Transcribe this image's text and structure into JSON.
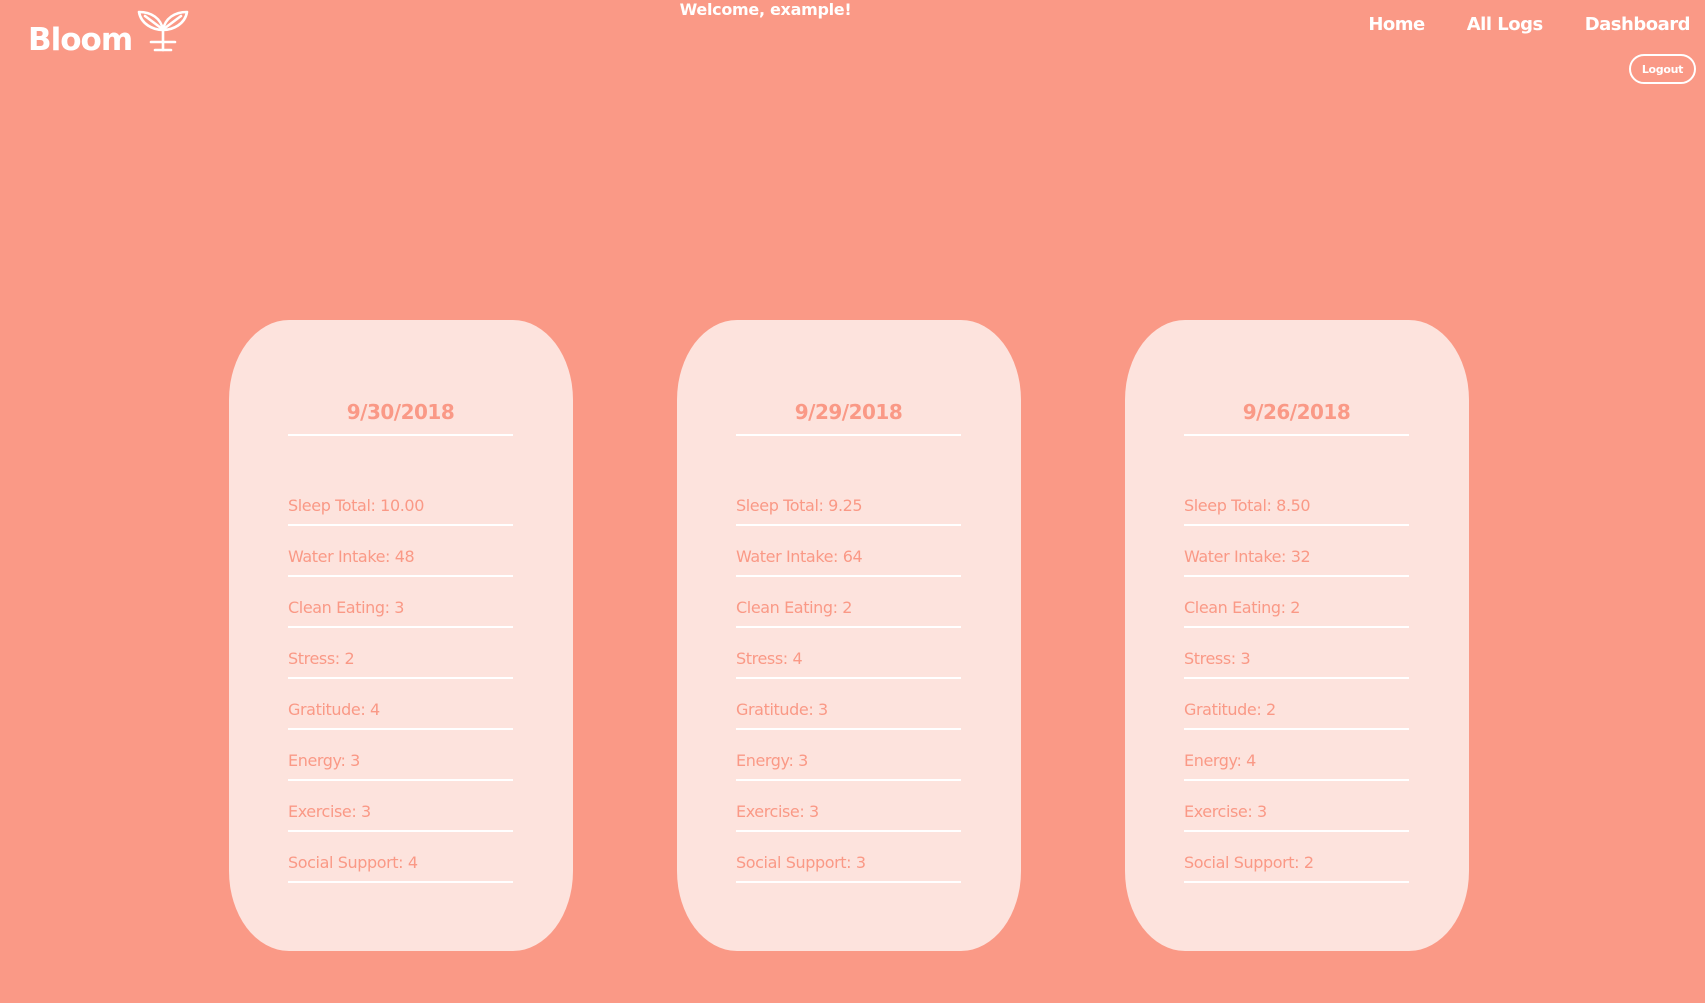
{
  "header": {
    "logo_text": "Bloom",
    "logo_icon": "sprout-icon",
    "welcome": "Welcome, example!",
    "nav": [
      {
        "label": "Home"
      },
      {
        "label": "All Logs"
      },
      {
        "label": "Dashboard"
      }
    ],
    "logout_label": "Logout"
  },
  "colors": {
    "background": "#fa9986",
    "card": "#fde3dd",
    "text_on_card": "#fa9986"
  },
  "logs": [
    {
      "date": "9/30/2018",
      "stats": [
        "Sleep Total: 10.00",
        "Water Intake: 48",
        "Clean Eating: 3",
        "Stress: 2",
        "Gratitude: 4",
        "Energy: 3",
        "Exercise: 3",
        "Social Support: 4"
      ]
    },
    {
      "date": "9/29/2018",
      "stats": [
        "Sleep Total: 9.25",
        "Water Intake: 64",
        "Clean Eating: 2",
        "Stress: 4",
        "Gratitude: 3",
        "Energy: 3",
        "Exercise: 3",
        "Social Support: 3"
      ]
    },
    {
      "date": "9/26/2018",
      "stats": [
        "Sleep Total: 8.50",
        "Water Intake: 32",
        "Clean Eating: 2",
        "Stress: 3",
        "Gratitude: 2",
        "Energy: 4",
        "Exercise: 3",
        "Social Support: 2"
      ]
    }
  ]
}
